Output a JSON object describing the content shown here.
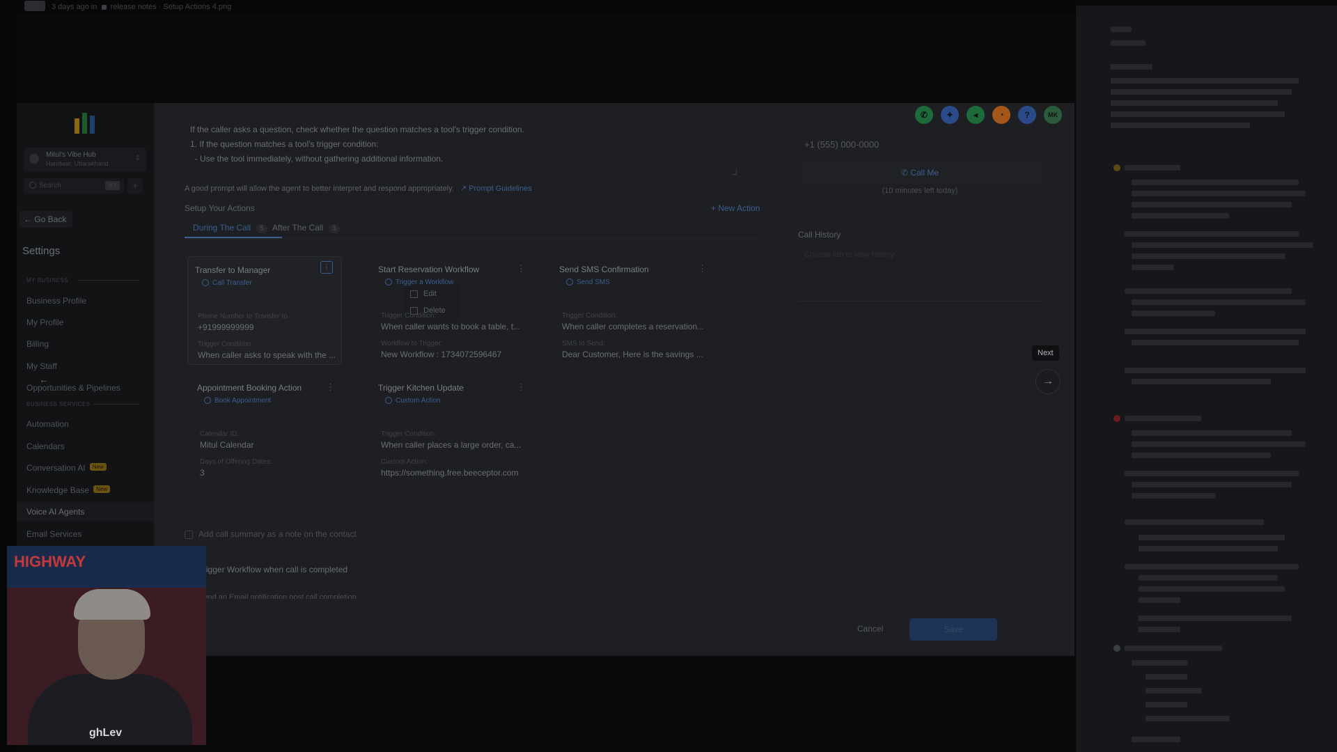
{
  "topbar": {
    "meta_text": "3 days ago in",
    "folder": "release notes",
    "file": "Setup Actions 4.png"
  },
  "sidebar": {
    "account": {
      "name": "Mitul's Vibe Hub",
      "sub": "Haridwar, Uttarakhand"
    },
    "search_placeholder": "Search",
    "search_shortcut": "⌘K",
    "add_symbol": "+",
    "go_back": "← Go Back",
    "settings_title": "Settings",
    "section_my_business": "MY BUSINESS",
    "section_business_services": "BUSINESS SERVICES",
    "items": [
      {
        "label": "Business Profile"
      },
      {
        "label": "My Profile"
      },
      {
        "label": "Billing"
      },
      {
        "label": "My Staff"
      },
      {
        "label": "Opportunities & Pipelines"
      },
      {
        "label": "Automation"
      },
      {
        "label": "Calendars"
      },
      {
        "label": "Conversation AI",
        "badge": "New"
      },
      {
        "label": "Knowledge Base",
        "badge": "New"
      },
      {
        "label": "Voice AI Agents"
      },
      {
        "label": "Email Services"
      }
    ]
  },
  "prompt": {
    "line1": "If the caller asks a question, check whether the question matches a tool's trigger condition.",
    "line2": "1. If the question matches a tool's trigger condition:",
    "line3": "  - Use the tool immediately, without gathering additional information.",
    "hint": "A good prompt will allow the agent to better interpret and respond appropriately.",
    "hint_link": "Prompt Guidelines"
  },
  "actions": {
    "setup_title": "Setup Your Actions",
    "new_action": "+ New Action",
    "tabs": [
      {
        "label": "During The Call",
        "count": "5"
      },
      {
        "label": "After The Call",
        "count": "3"
      }
    ],
    "cards": [
      {
        "title": "Transfer to Manager",
        "type": "Call Transfer",
        "f1_label": "Phone Number to Transfer to",
        "f1_value": "+91999999999",
        "f2_label": "Trigger Condition:",
        "f2_value": "When caller asks to speak with the ..."
      },
      {
        "title": "Start Reservation Workflow",
        "type": "Trigger a Workflow",
        "f1_label": "Trigger Condition:",
        "f1_value": "When caller wants to book a table, t...",
        "f2_label": "Workflow to Trigger:",
        "f2_value": "New Workflow : 1734072596467"
      },
      {
        "title": "Send SMS Confirmation",
        "type": "Send SMS",
        "f1_label": "Trigger Condition:",
        "f1_value": "When caller completes a reservation...",
        "f2_label": "SMS to Send:",
        "f2_value": "Dear Customer, Here is the savings ..."
      },
      {
        "title": "Appointment Booking Action",
        "type": "Book Appointment",
        "f1_label": "Calendar ID:",
        "f1_value": "Mitul Calendar",
        "f2_label": "Days of Offering Dates:",
        "f2_value": "3"
      },
      {
        "title": "Trigger Kitchen Update",
        "type": "Custom Action",
        "f1_label": "Trigger Condition:",
        "f1_value": "When caller places a large order, ca...",
        "f2_label": "Custom Action:",
        "f2_value": "https://something.free.beeceptor.com"
      }
    ],
    "context_menu": {
      "edit": "Edit",
      "delete": "Delete"
    }
  },
  "after_call": {
    "opt1": "Add call summary as a note on the contact",
    "opt2": "Trigger Workflow when call is completed",
    "opt3": "Send an Email notification post call completion"
  },
  "right_panel": {
    "phone_placeholder": "+1 (555) 000-0000",
    "call_me": "Call Me",
    "minutes_left": "(10 minutes left today)",
    "history_title": "Call History",
    "history_empty": "Choose tab to view history"
  },
  "top_icons": [
    {
      "icon": "phone-icon",
      "color": "#1d6b3a",
      "glyph": "✆"
    },
    {
      "icon": "magic-icon",
      "color": "#2a4a8a",
      "glyph": "✦"
    },
    {
      "icon": "megaphone-icon",
      "color": "#1d6b3a",
      "glyph": "◂"
    },
    {
      "icon": "bell-icon",
      "color": "#a5561a",
      "glyph": "◔"
    },
    {
      "icon": "help-icon",
      "color": "#2a4a8a",
      "glyph": "?"
    },
    {
      "icon": "avatar-icon",
      "color": "#2c5a3a",
      "glyph": "MK"
    }
  ],
  "tour": {
    "next_tooltip": "Next",
    "next_arrow": "→",
    "prev_arrow": "←"
  },
  "footer": {
    "cancel": "Cancel",
    "save": "Save"
  },
  "webcam": {
    "sign_text": "HIGHWAY",
    "brand_text": "ghLev"
  }
}
